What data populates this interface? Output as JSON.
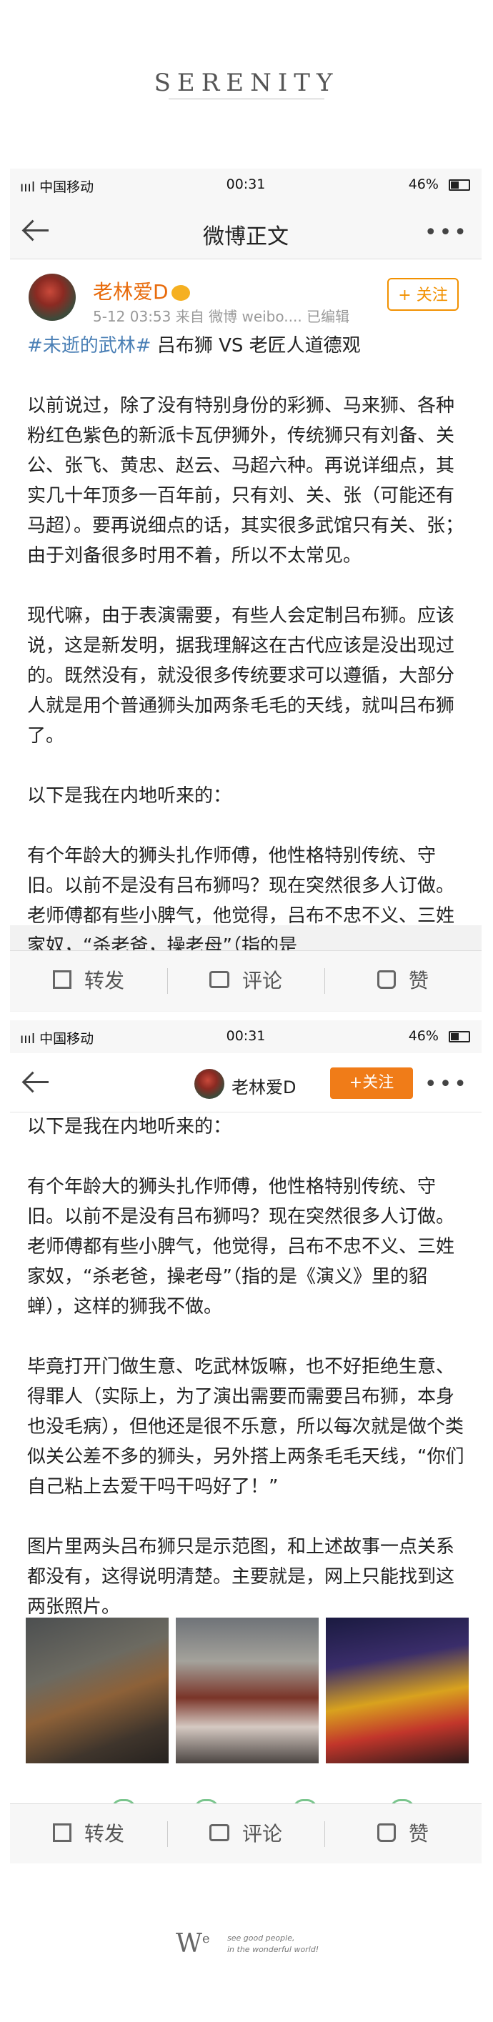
{
  "brand": "SERENITY",
  "status": {
    "carrier": "ıııl 中国移动 ",
    "time": "00:31",
    "battery": "46%",
    "battery_level": 0.46
  },
  "screen1": {
    "title": "微博正文",
    "more": "•••",
    "author": "老林爱D",
    "meta": "5-12 03:53  来自 微博 weibo....  已编辑",
    "follow_label": "+ 关注",
    "topic": "#未逝的武林#",
    "headline": " 吕布狮 VS 老匠人道德观",
    "paragraphs": [
      "以前说过，除了没有特别身份的彩狮、马来狮、各种粉红色紫色的新派卡瓦伊狮外，传统狮只有刘备、关公、张飞、黄忠、赵云、马超六种。再说详细点，其实几十年顶多一百年前，只有刘、关、张（可能还有马超）。要再说细点的话，其实很多武馆只有关、张；由于刘备很多时用不着，所以不太常见。",
      "现代嘛，由于表演需要，有些人会定制吕布狮。应该说，这是新发明，据我理解这在古代应该是没出现过的。既然没有，就没很多传统要求可以遵循，大部分人就是用个普通狮头加两条毛毛的天线，就叫吕布狮了。",
      "以下是我在内地听来的：",
      "有个年龄大的狮头扎作师傅，他性格特别传统、守旧。以前不是没有吕布狮吗？现在突然很多人订做。老师傅都有些小脾气，他觉得，吕布不忠不义、三姓家奴，“杀老爸，操老母”（指的是"
    ]
  },
  "actions": {
    "share": "转发",
    "comment": "评论",
    "like": "赞"
  },
  "screen2": {
    "author": "老林爱D",
    "follow_label": "+关注",
    "more": "•••",
    "paragraphs": [
      "以下是我在内地听来的：",
      "有个年龄大的狮头扎作师傅，他性格特别传统、守旧。以前不是没有吕布狮吗？现在突然很多人订做。老师傅都有些小脾气，他觉得，吕布不忠不义、三姓家奴，“杀老爸，操老母”（指的是《演义》里的貂蝉），这样的狮我不做。",
      "毕竟打开门做生意、吃武林饭嘛，也不好拒绝生意、得罪人（实际上，为了演出需要而需要吕布狮，本身也没毛病），但他还是很不乐意，所以每次就是做个类似关公差不多的狮头，另外搭上两条毛毛天线，“你们自己粘上去爱干吗干吗好了！”",
      "图片里两头吕布狮只是示范图，和上述故事一点关系都没有，这得说明清楚。主要就是，网上只能找到这两张照片。"
    ]
  },
  "watermark": {
    "letter": "W",
    "sup": "e",
    "line1": "see good people,",
    "line2": "in the wonderful world!"
  }
}
